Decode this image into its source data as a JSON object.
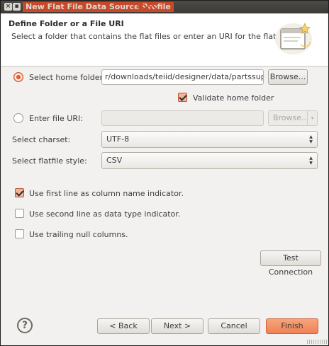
{
  "window": {
    "title": "New Flat File Data Source Profile",
    "close_glyph": "×",
    "min_glyph": "▪"
  },
  "header": {
    "title": "Define Folder or a File URI",
    "description": "Select a folder that contains the flat files or enter an URI for the flat file."
  },
  "form": {
    "home_folder": {
      "label": "Select home folder:",
      "value": "r/downloads/teiid/designer/data/partssupplier",
      "browse_label": "Browse...",
      "selected": true
    },
    "validate_home": {
      "label": "Validate home folder",
      "checked": true
    },
    "file_uri": {
      "label": "Enter file URI:",
      "value": "",
      "browse_label": "Browse...",
      "dropdown_glyph": "▾",
      "selected": false
    },
    "charset": {
      "label": "Select charset:",
      "value": "UTF-8"
    },
    "flatfile_style": {
      "label": "Select flatfile style:",
      "value": "CSV"
    },
    "options": [
      {
        "label": "Use first line as column name indicator.",
        "checked": true
      },
      {
        "label": "Use second line as data type indicator.",
        "checked": false
      },
      {
        "label": "Use trailing null columns.",
        "checked": false
      }
    ],
    "test_connection_label": "Test Connection"
  },
  "footer": {
    "help_glyph": "?",
    "back_label": "< Back",
    "next_label": "Next >",
    "cancel_label": "Cancel",
    "finish_label": "Finish"
  },
  "colors": {
    "accent": "#ef8254",
    "title_highlight": "#c8492a",
    "titlebar": "#3c3b37",
    "background": "#f2f1f0"
  }
}
